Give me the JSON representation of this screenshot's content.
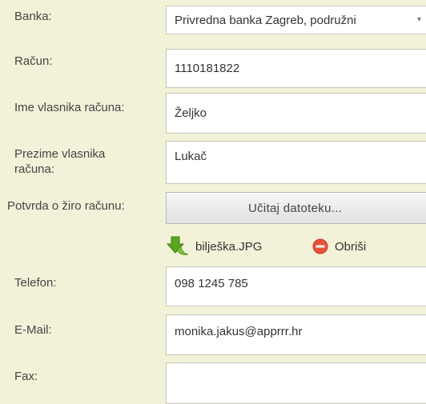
{
  "form": {
    "bank": {
      "label": "Banka:",
      "value": "Privredna banka Zagreb, podružni"
    },
    "account": {
      "label": "Račun:",
      "value": "1110181822"
    },
    "owner_first_name": {
      "label": "Ime vlasnika računa:",
      "value": "Željko"
    },
    "owner_last_name": {
      "label_line1": "Prezime vlasnika",
      "label_line2": "računa:",
      "value": "Lukač"
    },
    "account_confirmation": {
      "label": "Potvrda o žiro računu:",
      "upload_button": "Učitaj datoteku...",
      "file_name": "bilješka.JPG",
      "delete_label": "Obriši"
    },
    "phone": {
      "label": "Telefon:",
      "value": "098 1245 785"
    },
    "email": {
      "label": "E-Mail:",
      "value": "monika.jakus@apprrr.hr"
    },
    "fax": {
      "label": "Fax:",
      "value": ""
    }
  },
  "colors": {
    "background": "#f2f2d9",
    "delete_icon": "#e8513a",
    "file_icon": "#5aa51e"
  }
}
